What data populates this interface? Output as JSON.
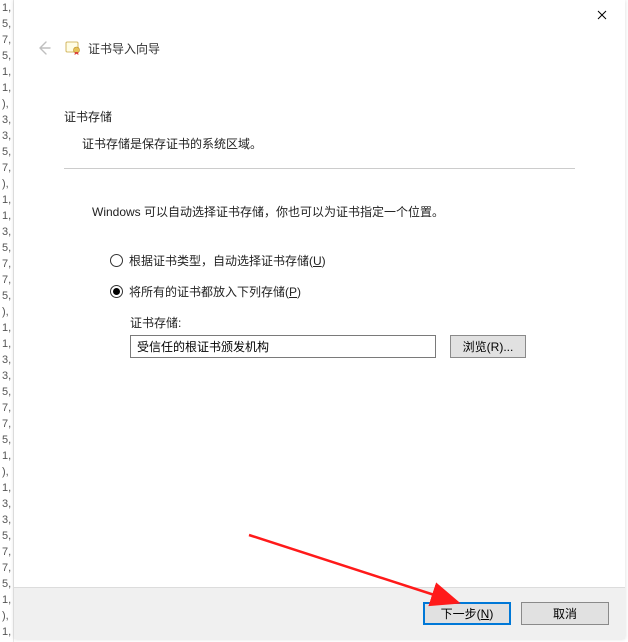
{
  "gutter_lines": [
    "1,",
    "5,",
    "7,",
    "5,",
    "1,",
    "1,",
    "),",
    "3,",
    "3,",
    "5,",
    "7,",
    "),",
    "1,",
    "1,",
    "3,",
    "5,",
    "7,",
    "7,",
    "5,",
    "),",
    "1,",
    "1,",
    "3,",
    "3,",
    "5,",
    "7,",
    "7,",
    "5,",
    "1,",
    "),",
    "1,",
    "3,",
    "3,",
    "5,",
    "7,",
    "7,",
    "5,",
    "1,",
    "),",
    "1,"
  ],
  "header": {
    "title": "证书导入向导"
  },
  "section": {
    "heading": "证书存储",
    "description": "证书存储是保存证书的系统区域。"
  },
  "instruction": "Windows 可以自动选择证书存储，你也可以为证书指定一个位置。",
  "radios": {
    "auto": {
      "label_pre": "根据证书类型，自动选择证书存储(",
      "mnemonic": "U",
      "label_post": ")"
    },
    "manual": {
      "label_pre": "将所有的证书都放入下列存储(",
      "mnemonic": "P",
      "label_post": ")"
    },
    "selected": "manual"
  },
  "store": {
    "label": "证书存储:",
    "value": "受信任的根证书颁发机构",
    "browse_pre": "浏览(",
    "browse_mnemonic": "R",
    "browse_post": ")..."
  },
  "footer": {
    "next_pre": "下一步(",
    "next_mnemonic": "N",
    "next_post": ")",
    "cancel": "取消"
  }
}
